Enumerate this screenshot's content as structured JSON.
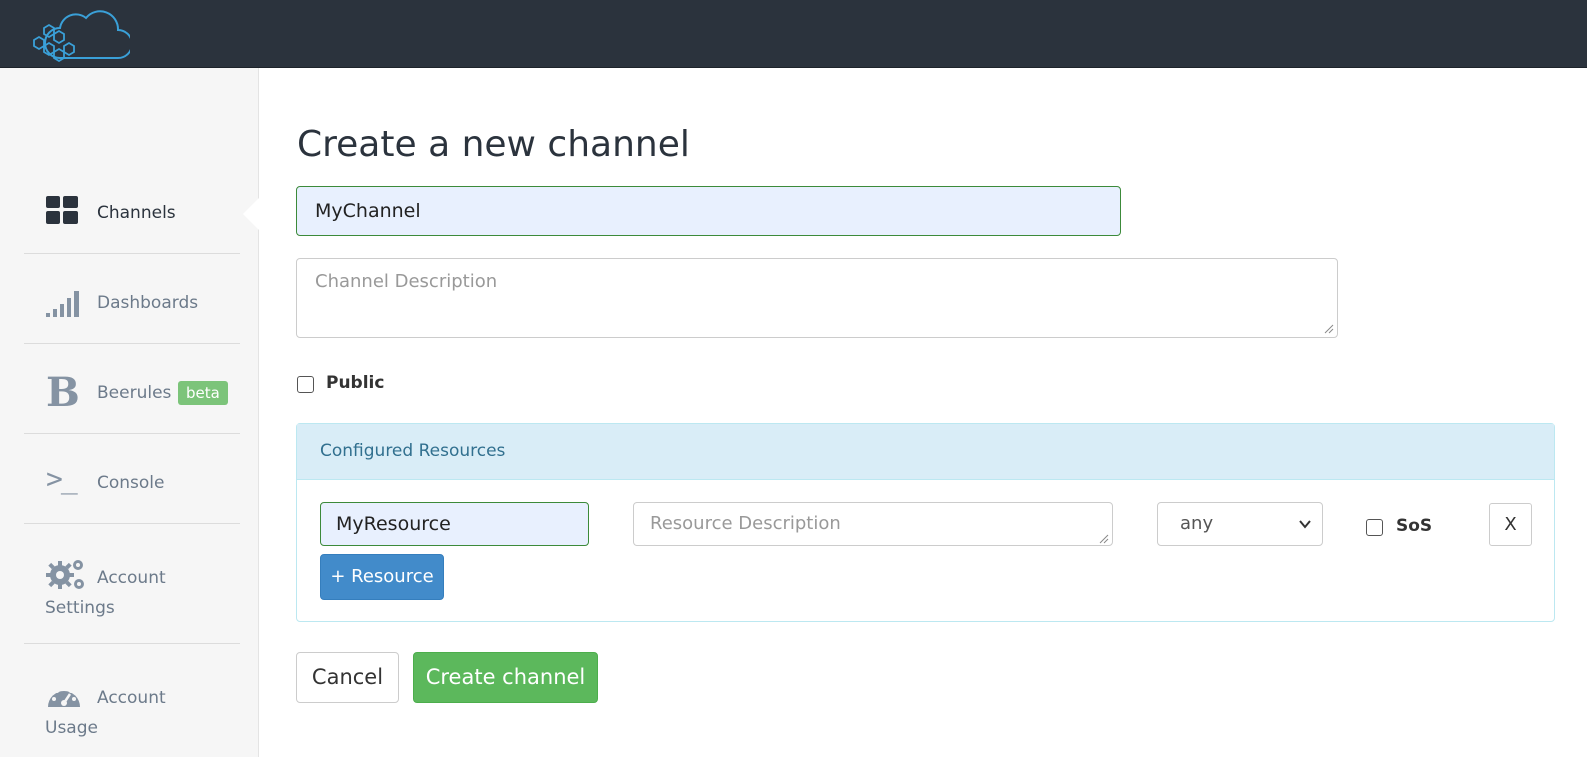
{
  "brand": {
    "logo_icon": "cloud-hexagon-logo",
    "colors": {
      "topbar": "#2b333d",
      "primary": "#428bca",
      "success": "#5cb85c",
      "info_bg": "#d9edf7"
    }
  },
  "sidebar": {
    "items": [
      {
        "label": "Channels",
        "icon": "grid-icon",
        "active": true
      },
      {
        "label": "Dashboards",
        "icon": "signal-bars-icon"
      },
      {
        "label": "Beerules",
        "icon": "b-letter-icon",
        "icon_text": "B",
        "badge": "beta"
      },
      {
        "label": "Console",
        "icon": "terminal-prompt-icon",
        "icon_text": ">_"
      },
      {
        "label": "Account Settings",
        "icon": "gears-icon"
      },
      {
        "label": "Account Usage",
        "icon": "speedometer-icon"
      }
    ]
  },
  "form": {
    "title": "Create a new channel",
    "name_value": "MyChannel",
    "description_placeholder": "Channel Description",
    "public_label": "Public",
    "public_checked": false
  },
  "resources": {
    "panel_title": "Configured Resources",
    "rows": [
      {
        "name": "MyResource",
        "description_placeholder": "Resource Description",
        "type": "any",
        "sos_label": "SoS",
        "sos_checked": false,
        "remove_label": "X"
      }
    ],
    "add_label": "+ Resource"
  },
  "actions": {
    "cancel_label": "Cancel",
    "create_label": "Create channel"
  }
}
